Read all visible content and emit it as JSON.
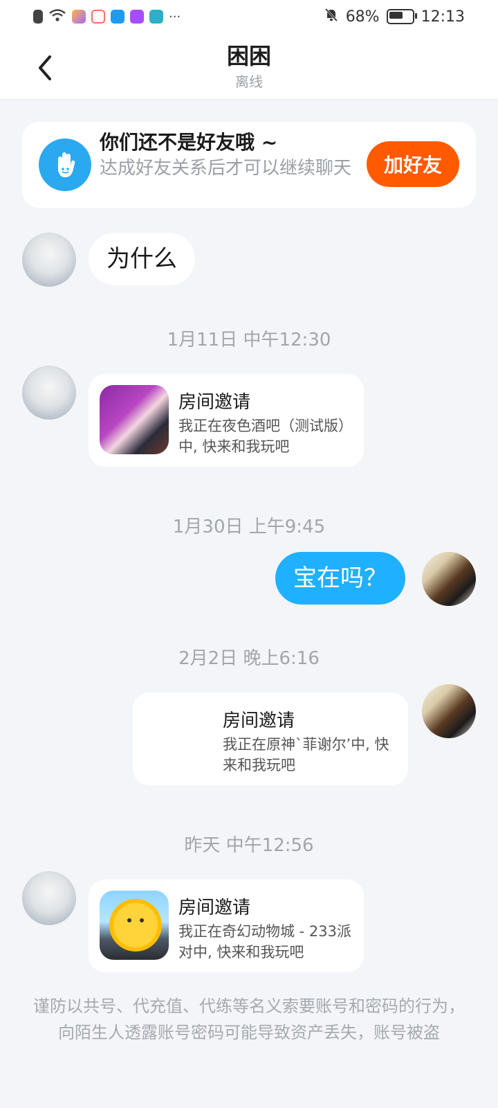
{
  "status_bar": {
    "battery": "68%",
    "time": "12:13",
    "battery_level": 0.68,
    "more": "···"
  },
  "header": {
    "title": "困困",
    "subtitle": "离线"
  },
  "friend_prompt": {
    "title": "你们还不是好友哦 ~",
    "description": "达成好友关系后才可以继续聊天",
    "button": "加好友"
  },
  "messages": {
    "m1_text": "为什么",
    "ts1": "1月11日 中午12:30",
    "invite1": {
      "title": "房间邀请",
      "desc": "我正在夜色酒吧（测试版）中, 快来和我玩吧"
    },
    "ts2": "1月30日 上午9:45",
    "m2_text": "宝在吗？",
    "ts3": "2月2日 晚上6:16",
    "invite2": {
      "title": "房间邀请",
      "desc": "我正在原神`菲谢尔’中, 快来和我玩吧"
    },
    "ts4": "昨天 中午12:56",
    "invite3": {
      "title": "房间邀请",
      "desc": "我正在奇幻动物城 - 233派对中, 快来和我玩吧"
    }
  },
  "footer": {
    "warning": "谨防以共号、代充值、代练等名义索要账号和密码的行为，向陌生人透露账号密码可能导致资产丢失，账号被盗"
  },
  "colors": {
    "accent_orange": "#ff5a00",
    "my_bubble": "#1fb0ff",
    "background": "#f3f5f8"
  }
}
